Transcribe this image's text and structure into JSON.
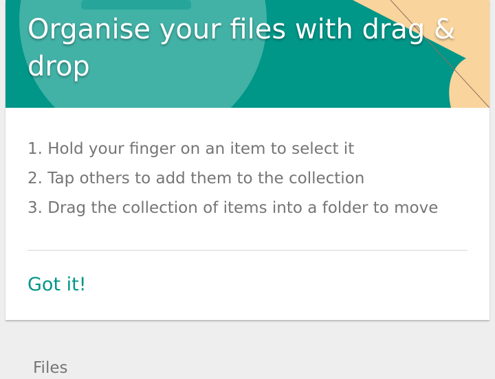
{
  "dialog": {
    "title": "Organise your files with drag & drop",
    "steps": [
      "1. Hold your finger on an item to select it",
      "2. Tap others to add them to the collection",
      "3. Drag the collection of items into a folder to move"
    ],
    "confirm_label": "Got it!"
  },
  "list": {
    "section_label": "Files"
  },
  "colors": {
    "accent": "#009688",
    "accent_light": "#4db6ac",
    "peach": "#f9d49c",
    "background": "#eeeeee"
  }
}
